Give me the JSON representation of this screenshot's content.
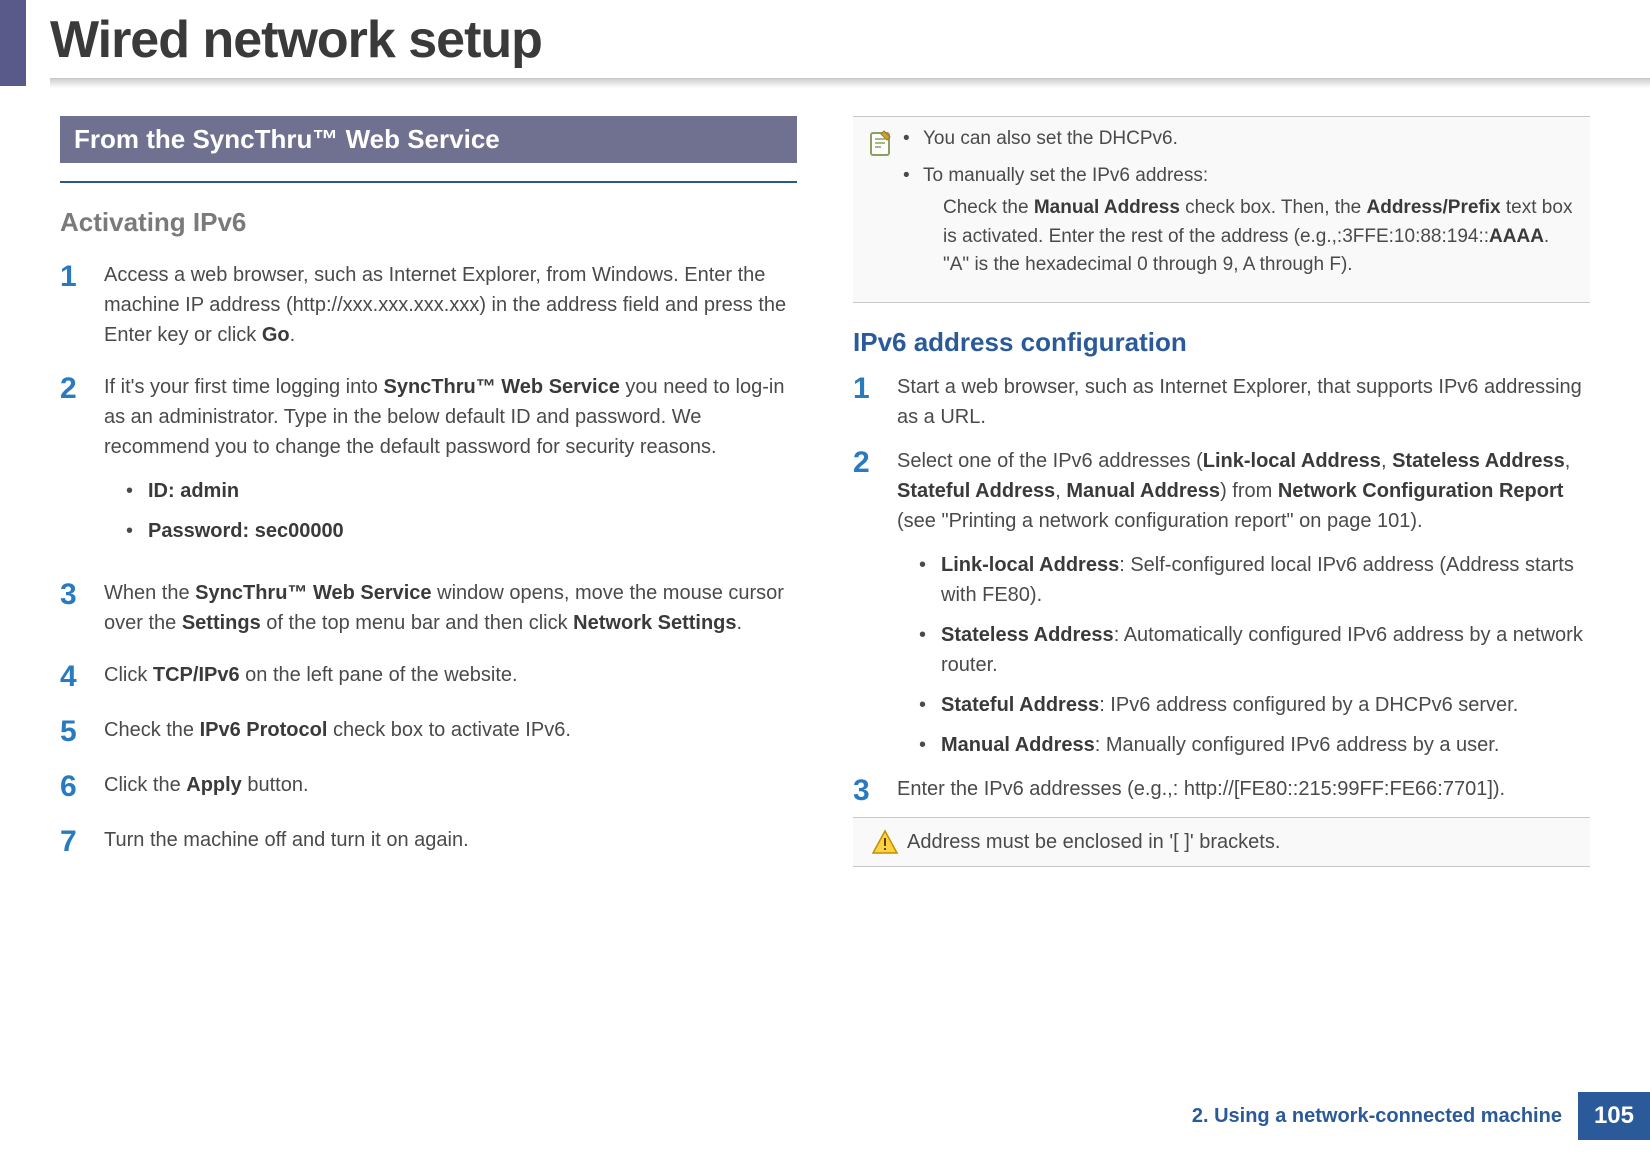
{
  "header": {
    "title": "Wired network setup"
  },
  "col_left": {
    "section_title": "From the SyncThru™ Web Service",
    "subheading": "Activating IPv6",
    "steps": [
      {
        "num": "1",
        "text_pre": "Access a web browser, such as Internet Explorer, from Windows. Enter the machine IP address (http://xxx.xxx.xxx.xxx) in the address field and press the Enter key or click ",
        "bold1": "Go",
        "text_post": "."
      },
      {
        "num": "2",
        "text_pre": "If it's your first time logging into ",
        "bold1": "SyncThru™ Web Service",
        "text_mid": " you need to log-in as an administrator. Type in the below default ID and password. We recommend you to change the default password for security reasons.",
        "bullets": [
          {
            "bold": "ID: admin"
          },
          {
            "bold": "Password: sec00000"
          }
        ]
      },
      {
        "num": "3",
        "text_pre": "When the ",
        "bold1": "SyncThru™ Web Service",
        "text_mid": " window opens, move the mouse cursor over the ",
        "bold2": "Settings",
        "text_mid2": " of the top menu bar and then click ",
        "bold3": "Network Settings",
        "text_post": "."
      },
      {
        "num": "4",
        "text_pre": "Click ",
        "bold1": "TCP/IPv6",
        "text_post": " on the left pane of the website."
      },
      {
        "num": "5",
        "text_pre": "Check the ",
        "bold1": "IPv6 Protocol",
        "text_post": " check box to activate IPv6."
      },
      {
        "num": "6",
        "text_pre": "Click the ",
        "bold1": "Apply",
        "text_post": " button."
      },
      {
        "num": "7",
        "text_pre": "Turn the machine off and turn it on again."
      }
    ]
  },
  "col_right": {
    "note": {
      "bullet1": "You can also set the DHCPv6.",
      "bullet2": "To manually set the IPv6 address:",
      "detail_pre": "Check the ",
      "detail_b1": "Manual Address",
      "detail_mid1": " check box. Then, the ",
      "detail_b2": "Address/Prefix",
      "detail_mid2": " text box is activated. Enter the rest of the address (e.g.,:3FFE:10:88:194::",
      "detail_b3": "AAAA",
      "detail_post": ". \"A\" is the hexadecimal 0 through 9, A through F)."
    },
    "subheading": "IPv6 address configuration",
    "steps": [
      {
        "num": "1",
        "text": "Start a web browser, such as Internet Explorer, that supports IPv6 addressing as a URL."
      },
      {
        "num": "2",
        "text_pre": "Select one of the IPv6 addresses (",
        "b1": "Link-local Address",
        "sep1": ", ",
        "b2": "Stateless Address",
        "sep2": ", ",
        "b3": "Stateful Address",
        "sep3": ", ",
        "b4": "Manual Address",
        "text_mid": ") from ",
        "b5": "Network Configuration Report",
        "text_post": " (see \"Printing a network configuration report\" on page 101).",
        "bullets": [
          {
            "bold": "Link-local Address",
            "desc": ": Self-configured local IPv6 address (Address starts with FE80)."
          },
          {
            "bold": "Stateless Address",
            "desc": ": Automatically configured IPv6 address by a network router."
          },
          {
            "bold": "Stateful Address",
            "desc": ": IPv6 address configured by a DHCPv6 server."
          },
          {
            "bold": "Manual Address",
            "desc": ": Manually configured IPv6 address by a user."
          }
        ]
      },
      {
        "num": "3",
        "text": "Enter the IPv6 addresses (e.g.,: http://[FE80::215:99FF:FE66:7701])."
      }
    ],
    "warning": "Address must be enclosed in '[ ]' brackets."
  },
  "footer": {
    "chapter": "2.  Using a network-connected machine",
    "page": "105"
  }
}
